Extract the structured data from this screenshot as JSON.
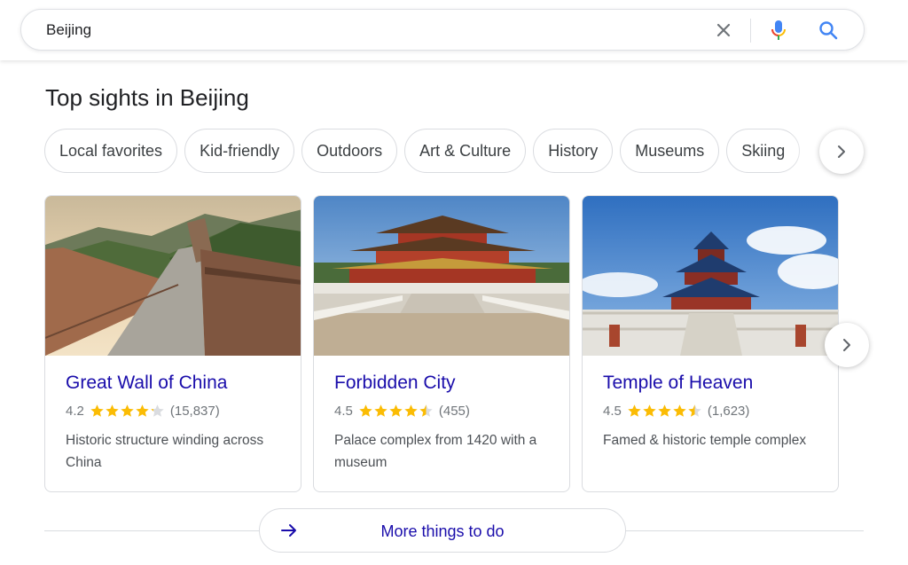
{
  "search": {
    "query": "Beijing"
  },
  "section": {
    "title": "Top sights in Beijing"
  },
  "chips": [
    "Local favorites",
    "Kid-friendly",
    "Outdoors",
    "Art & Culture",
    "History",
    "Museums",
    "Skiing"
  ],
  "cards": [
    {
      "name": "Great Wall of China",
      "rating": "4.2",
      "stars": 4.2,
      "reviews": "(15,837)",
      "description": "Historic structure winding across China",
      "image": "great-wall-photo"
    },
    {
      "name": "Forbidden City",
      "rating": "4.5",
      "stars": 4.5,
      "reviews": "(455)",
      "description": "Palace complex from 1420 with a museum",
      "image": "forbidden-city-photo"
    },
    {
      "name": "Temple of Heaven",
      "rating": "4.5",
      "stars": 4.5,
      "reviews": "(1,623)",
      "description": "Famed & historic temple complex",
      "image": "temple-of-heaven-photo"
    }
  ],
  "more": {
    "label": "More things to do"
  },
  "icons": {
    "clear": "close-icon",
    "mic": "mic-icon",
    "search": "search-icon",
    "next": "chevron-right-icon",
    "more": "arrow-right-icon"
  },
  "colors": {
    "link": "#1a0dab",
    "star": "#fbbc04",
    "star_empty": "#dadce0",
    "search_blue": "#4285f4"
  }
}
